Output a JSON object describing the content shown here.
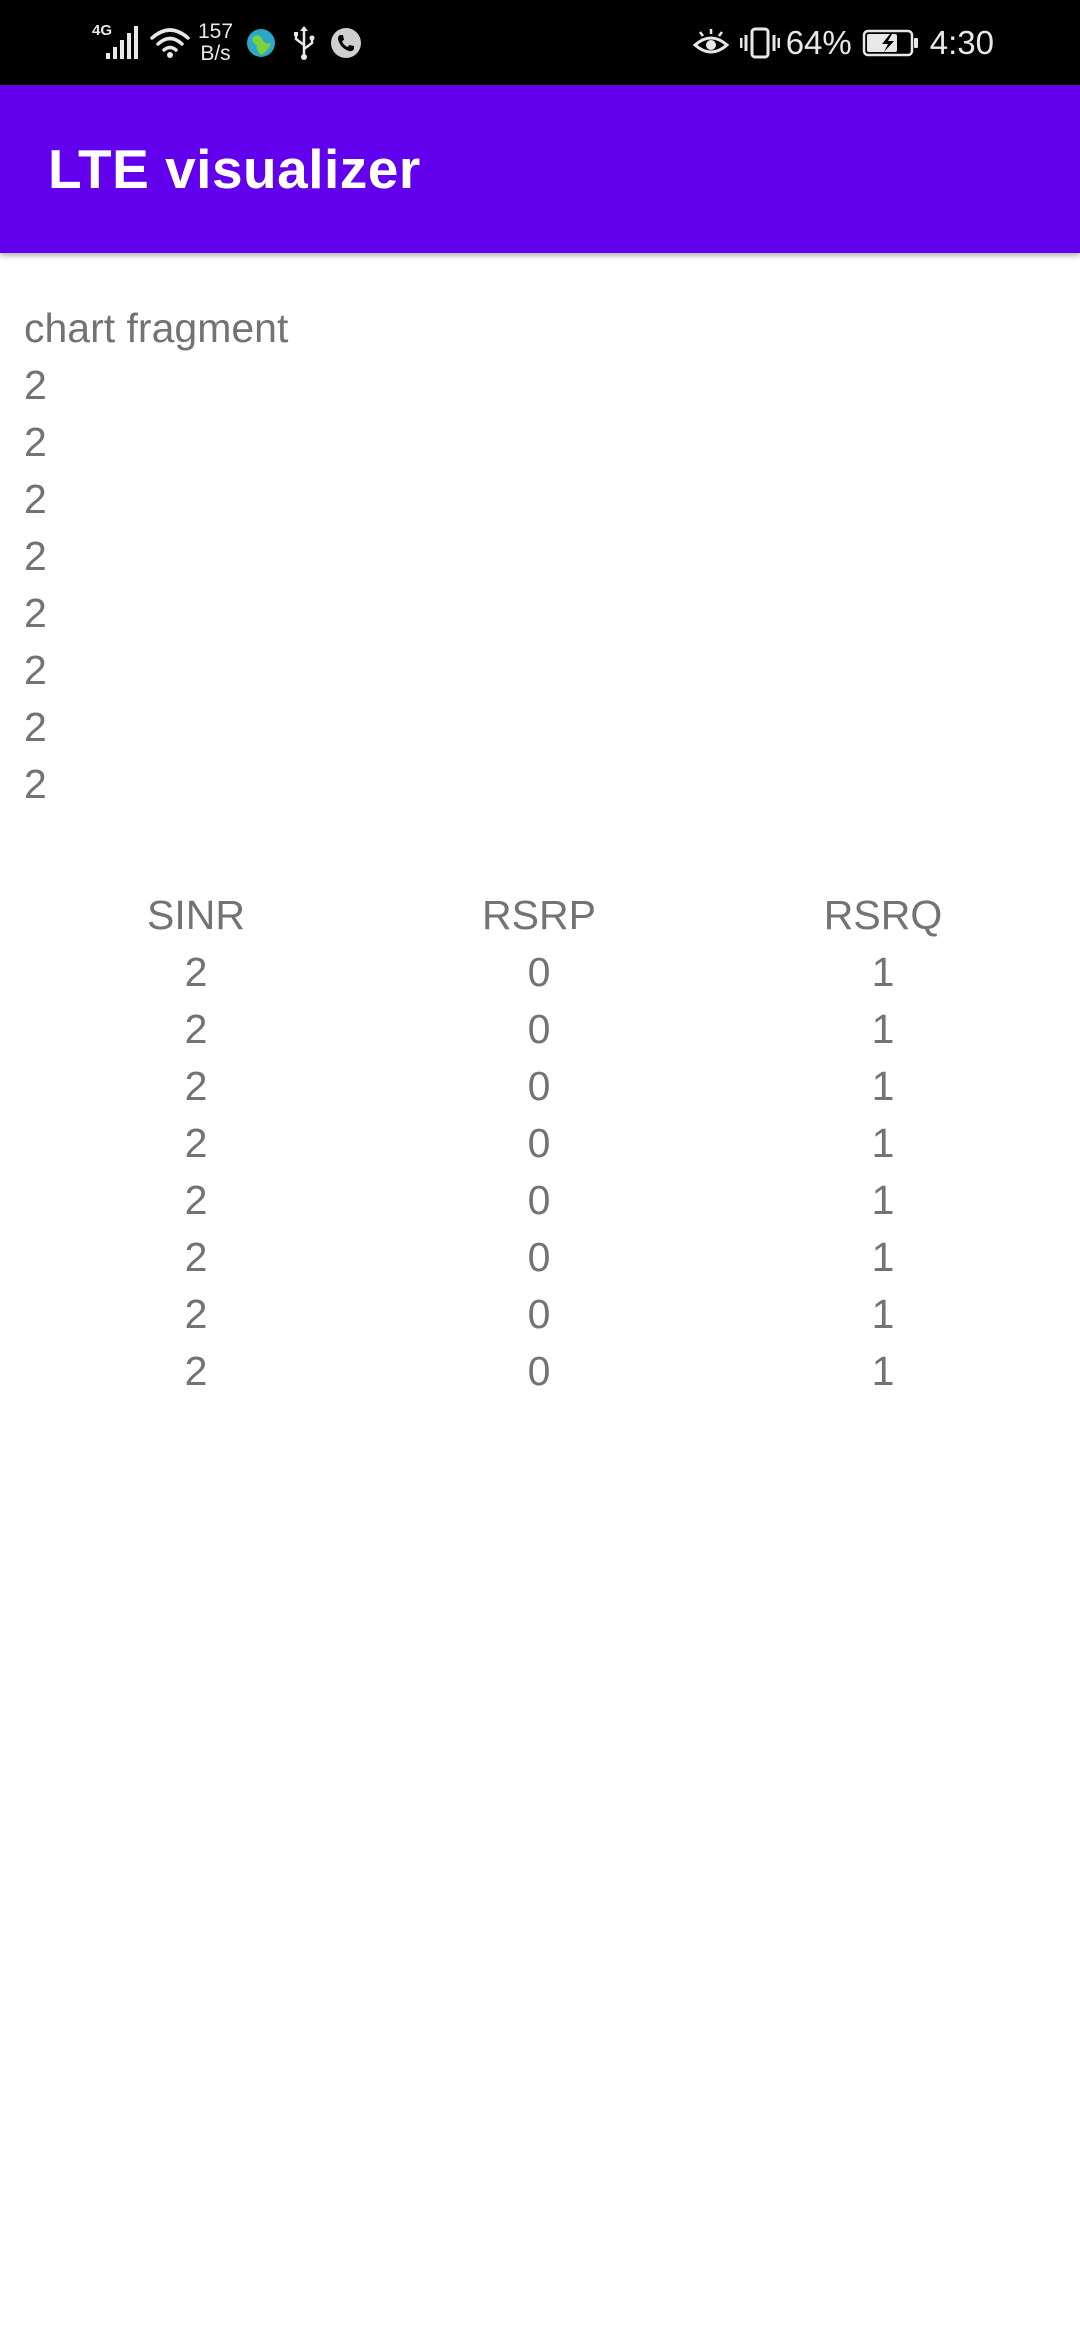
{
  "status_bar": {
    "network_type": "4G",
    "speed_value": "157",
    "speed_unit": "B/s",
    "battery_percent": "64%",
    "time": "4:30",
    "icons": [
      "signal-icon",
      "wifi-icon",
      "globe-app-icon",
      "usb-icon",
      "phone-app-icon",
      "eye-comfort-icon",
      "vibrate-icon",
      "battery-charging-icon"
    ]
  },
  "app_bar": {
    "title": "LTE visualizer",
    "color": "#6200ee"
  },
  "chart_fragment": {
    "heading": "chart fragment",
    "values": [
      "2",
      "2",
      "2",
      "2",
      "2",
      "2",
      "2",
      "2"
    ]
  },
  "table": {
    "headers": [
      "SINR",
      "RSRP",
      "RSRQ"
    ],
    "rows": [
      [
        "2",
        "0",
        "1"
      ],
      [
        "2",
        "0",
        "1"
      ],
      [
        "2",
        "0",
        "1"
      ],
      [
        "2",
        "0",
        "1"
      ],
      [
        "2",
        "0",
        "1"
      ],
      [
        "2",
        "0",
        "1"
      ],
      [
        "2",
        "0",
        "1"
      ],
      [
        "2",
        "0",
        "1"
      ]
    ]
  }
}
